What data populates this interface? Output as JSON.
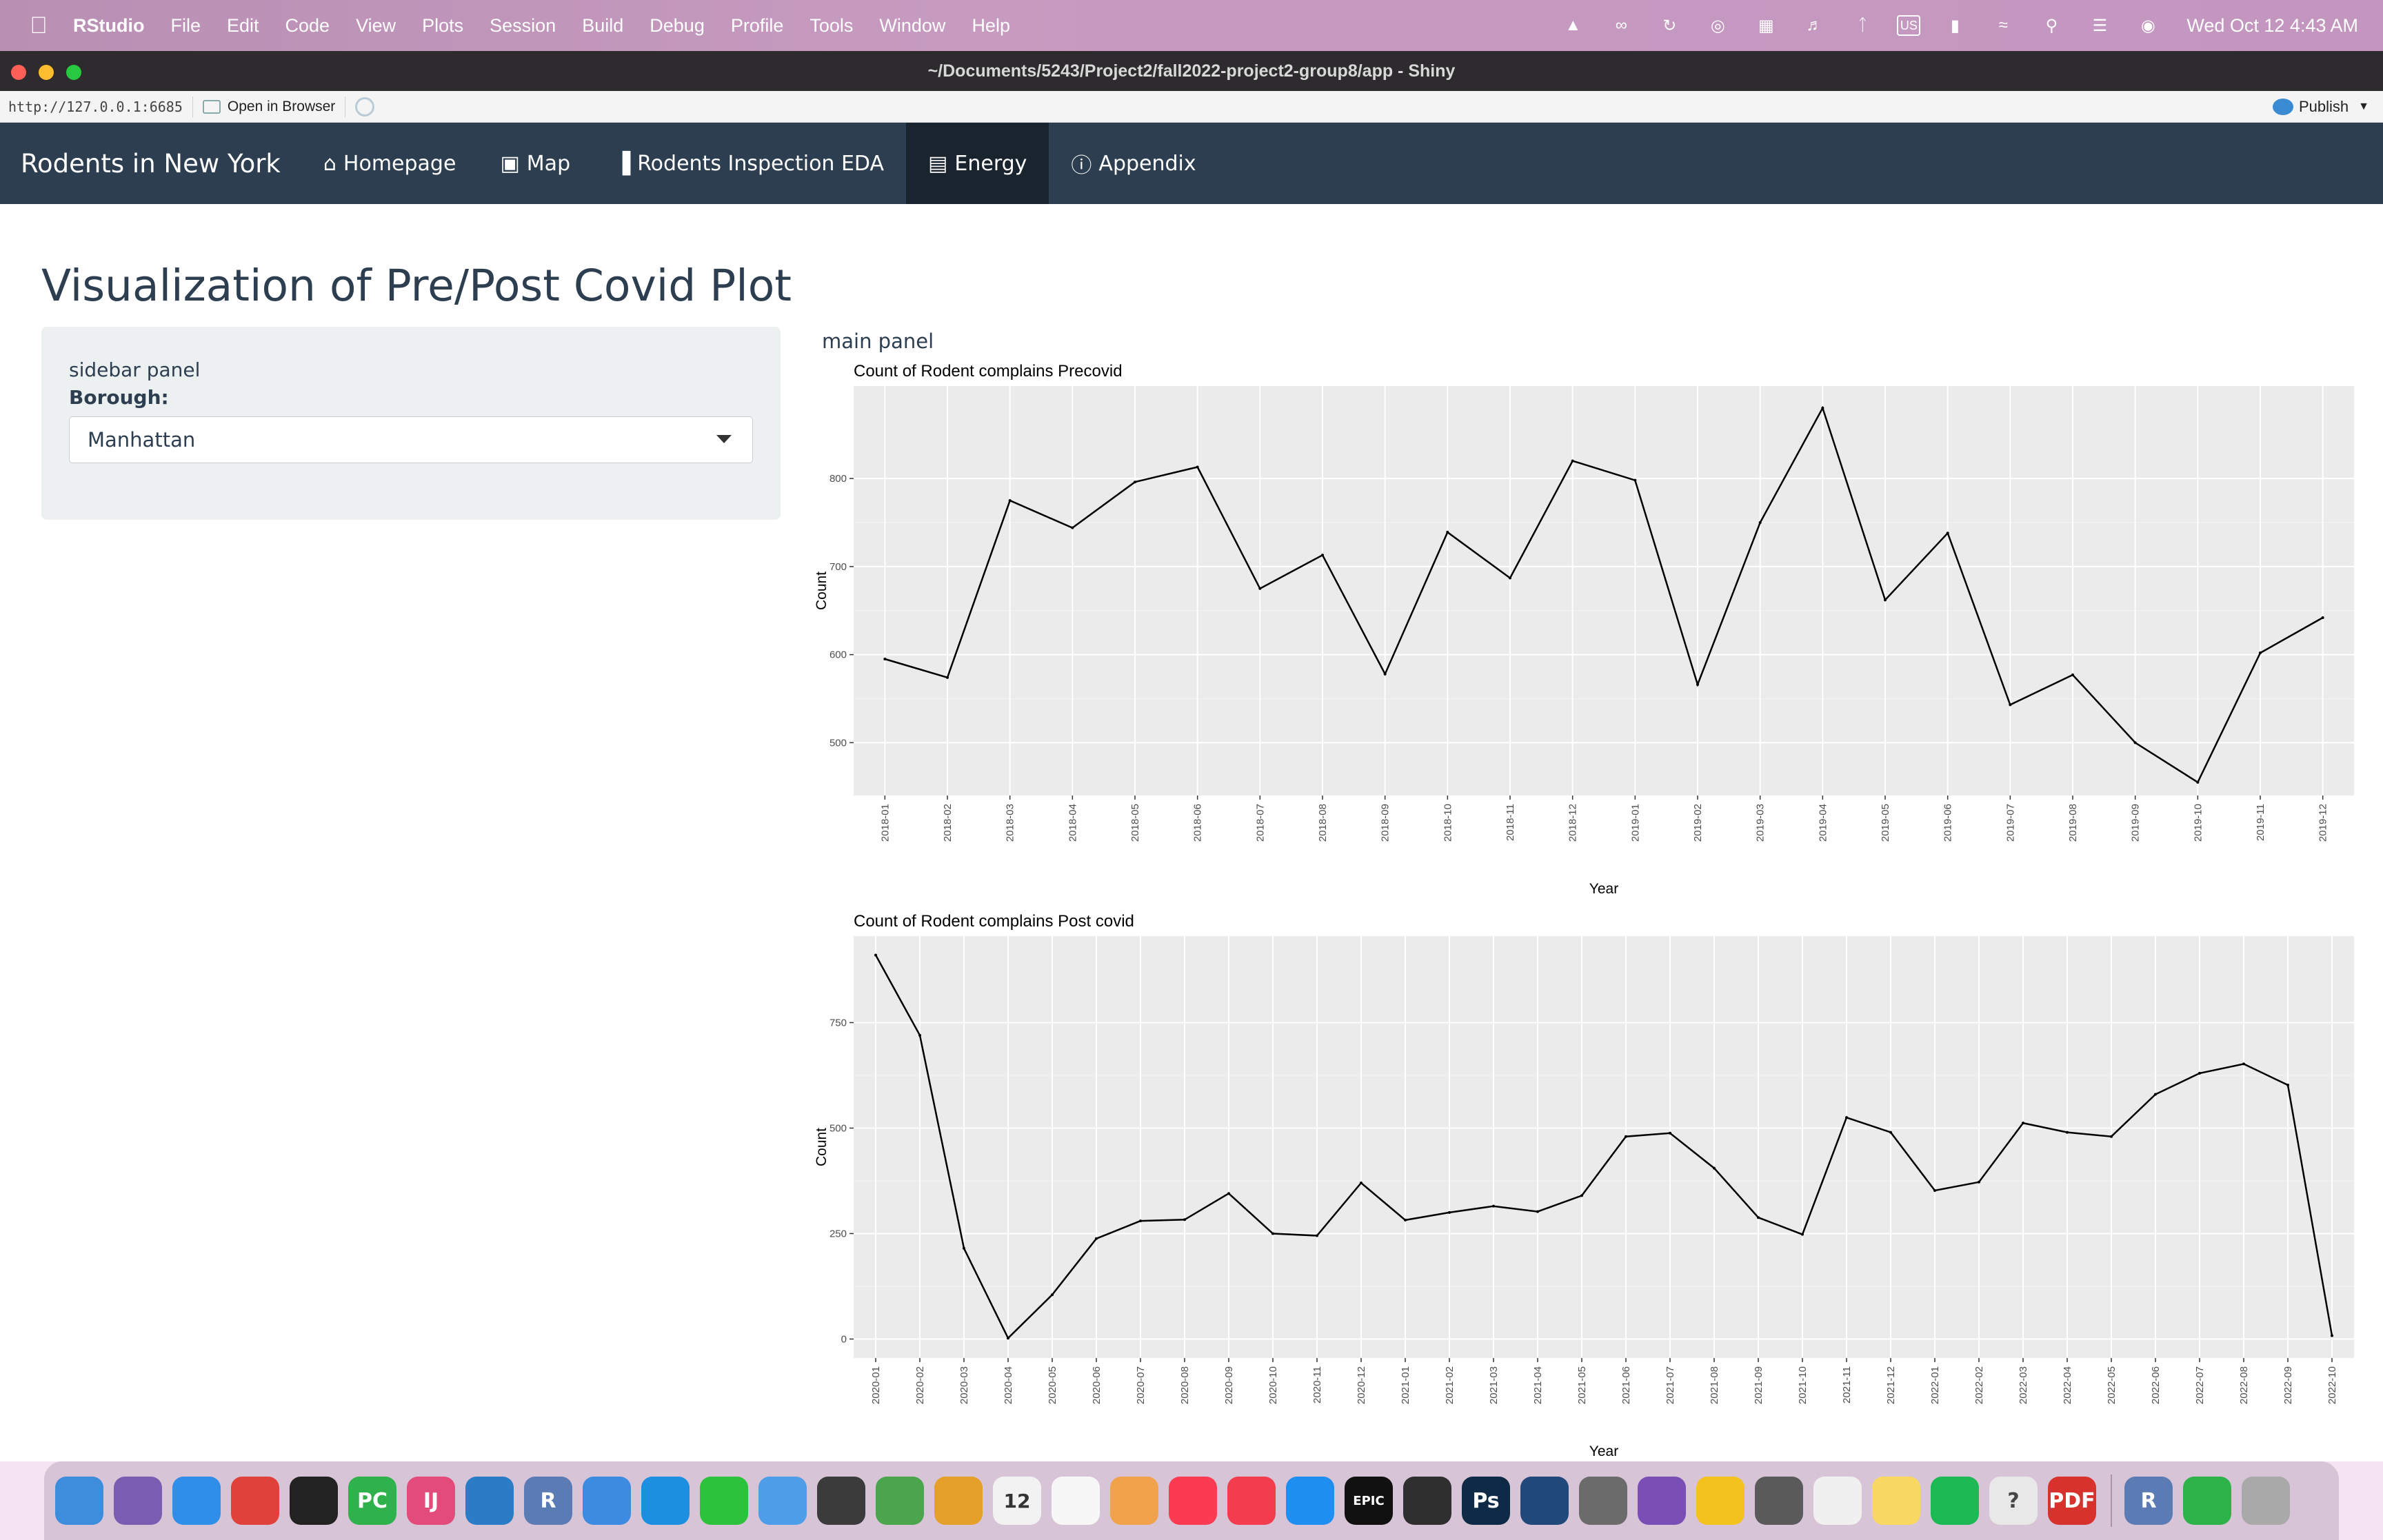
{
  "menubar": {
    "apple": "",
    "items": [
      "RStudio",
      "File",
      "Edit",
      "Code",
      "View",
      "Plots",
      "Session",
      "Build",
      "Debug",
      "Profile",
      "Tools",
      "Window",
      "Help"
    ],
    "keyboard_layout": "US",
    "clock": "Wed Oct 12  4:43 AM"
  },
  "window": {
    "title": "~/Documents/5243/Project2/fall2022-project2-group8/app - Shiny"
  },
  "viewer": {
    "url": "http://127.0.0.1:6685",
    "open_in_browser": "Open in Browser",
    "publish": "Publish"
  },
  "navbar": {
    "brand": "Rodents in New York",
    "tabs": [
      {
        "label": "Homepage",
        "icon": "home-icon"
      },
      {
        "label": "Map",
        "icon": "map-icon"
      },
      {
        "label": "Rodents Inspection EDA",
        "icon": "bar-chart-icon"
      },
      {
        "label": "Energy",
        "icon": "dashboard-icon",
        "active": true
      },
      {
        "label": "Appendix",
        "icon": "info-icon"
      }
    ]
  },
  "page": {
    "title": "Visualization of Pre/Post Covid Plot",
    "sidebar": {
      "label": "sidebar panel",
      "borough_label": "Borough:",
      "borough_value": "Manhattan"
    },
    "main_label": "main panel"
  },
  "chart_data": [
    {
      "type": "line",
      "title": "Count of Rodent complains Precovid",
      "xlabel": "Year",
      "ylabel": "Count",
      "ylim": [
        440,
        905
      ],
      "yticks": [
        500,
        600,
        700,
        800
      ],
      "grid": true,
      "categories": [
        "2018-01",
        "2018-02",
        "2018-03",
        "2018-04",
        "2018-05",
        "2018-06",
        "2018-07",
        "2018-08",
        "2018-09",
        "2018-10",
        "2018-11",
        "2018-12",
        "2019-01",
        "2019-02",
        "2019-03",
        "2019-04",
        "2019-05",
        "2019-06",
        "2019-07",
        "2019-08",
        "2019-09",
        "2019-10",
        "2019-11",
        "2019-12"
      ],
      "values": [
        595,
        574,
        775,
        744,
        796,
        813,
        675,
        713,
        578,
        739,
        687,
        820,
        798,
        566,
        750,
        880,
        662,
        738,
        543,
        577,
        500,
        455,
        602,
        642
      ]
    },
    {
      "type": "line",
      "title": "Count of Rodent complains Post covid",
      "xlabel": "Year",
      "ylabel": "Count",
      "ylim": [
        -45,
        955
      ],
      "yticks": [
        0,
        250,
        500,
        750
      ],
      "grid": true,
      "categories": [
        "2020-01",
        "2020-02",
        "2020-03",
        "2020-04",
        "2020-05",
        "2020-06",
        "2020-07",
        "2020-08",
        "2020-09",
        "2020-10",
        "2020-11",
        "2020-12",
        "2021-01",
        "2021-02",
        "2021-03",
        "2021-04",
        "2021-05",
        "2021-06",
        "2021-07",
        "2021-08",
        "2021-09",
        "2021-10",
        "2021-11",
        "2021-12",
        "2022-01",
        "2022-02",
        "2022-03",
        "2022-04",
        "2022-05",
        "2022-06",
        "2022-07",
        "2022-08",
        "2022-09",
        "2022-10"
      ],
      "values": [
        910,
        720,
        215,
        2,
        105,
        238,
        280,
        283,
        345,
        250,
        245,
        370,
        282,
        300,
        315,
        302,
        340,
        480,
        488,
        405,
        288,
        248,
        525,
        490,
        352,
        372,
        512,
        490,
        480,
        580,
        630,
        652,
        602,
        8
      ]
    }
  ],
  "dock": {
    "icons": [
      "finder-icon",
      "launchpad-icon",
      "safari-icon",
      "chrome-icon",
      "terminal-icon",
      "pycharm-icon",
      "intellij-icon",
      "vscode-icon",
      "r-icon",
      "xcode-icon",
      "docker-icon",
      "wechat-icon",
      "mail-icon",
      "claquette-icon",
      "maps-icon",
      "photos-icon",
      "calendar-icon",
      "reminders-icon",
      "cloud-icon",
      "music-icon",
      "news-icon",
      "appstore-icon",
      "epic-games-icon",
      "unity-icon",
      "photoshop-icon",
      "screen-icon",
      "system-preferences-icon",
      "downloads-icon",
      "drive-icon",
      "robot-icon",
      "tableau-icon",
      "notes-icon",
      "spotify-icon",
      "help-icon",
      "pdf-icon",
      "r-icon",
      "numbers-icon",
      "trash-icon"
    ],
    "labels": {
      "pycharm": "PC",
      "intellij": "IJ",
      "r": "R",
      "ps": "Ps",
      "epic": "EPIC",
      "pdf": "PDF",
      "calendar_month": "OCT",
      "calendar_day": "12"
    }
  }
}
